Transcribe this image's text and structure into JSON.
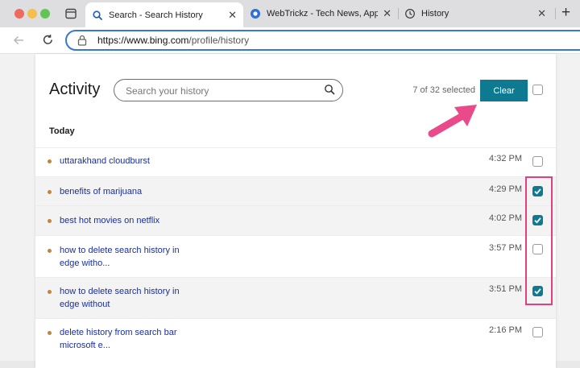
{
  "colors": {
    "accent": "#0d7a92",
    "highlight": "#e0407f",
    "arrow": "#e94a8a"
  },
  "browser": {
    "tabs": [
      {
        "title": "Search - Search History",
        "icon": "search-icon",
        "active": true
      },
      {
        "title": "WebTrickz - Tech News, Apps, …",
        "icon": "webtrickz-favicon",
        "active": false
      },
      {
        "title": "History",
        "icon": "history-icon",
        "active": false
      }
    ],
    "new_tab_label": "+",
    "url_host": "https://www.bing.com",
    "url_path": "/profile/history"
  },
  "page": {
    "title": "Activity",
    "search_placeholder": "Search your history",
    "selection_count": "7 of 32 selected",
    "clear_label": "Clear",
    "section_today": "Today",
    "items": [
      {
        "query": "uttarakhand cloudburst",
        "time": "4:32 PM",
        "checked": false
      },
      {
        "query": "benefits of marijuana",
        "time": "4:29 PM",
        "checked": true
      },
      {
        "query": "best hot movies on netflix",
        "time": "4:02 PM",
        "checked": true
      },
      {
        "query": "how to delete search history in edge witho...",
        "time": "3:57 PM",
        "checked": false
      },
      {
        "query": "how to delete search history in edge without",
        "time": "3:51 PM",
        "checked": true
      },
      {
        "query": "delete history from search bar microsoft e...",
        "time": "2:16 PM",
        "checked": false
      }
    ]
  }
}
